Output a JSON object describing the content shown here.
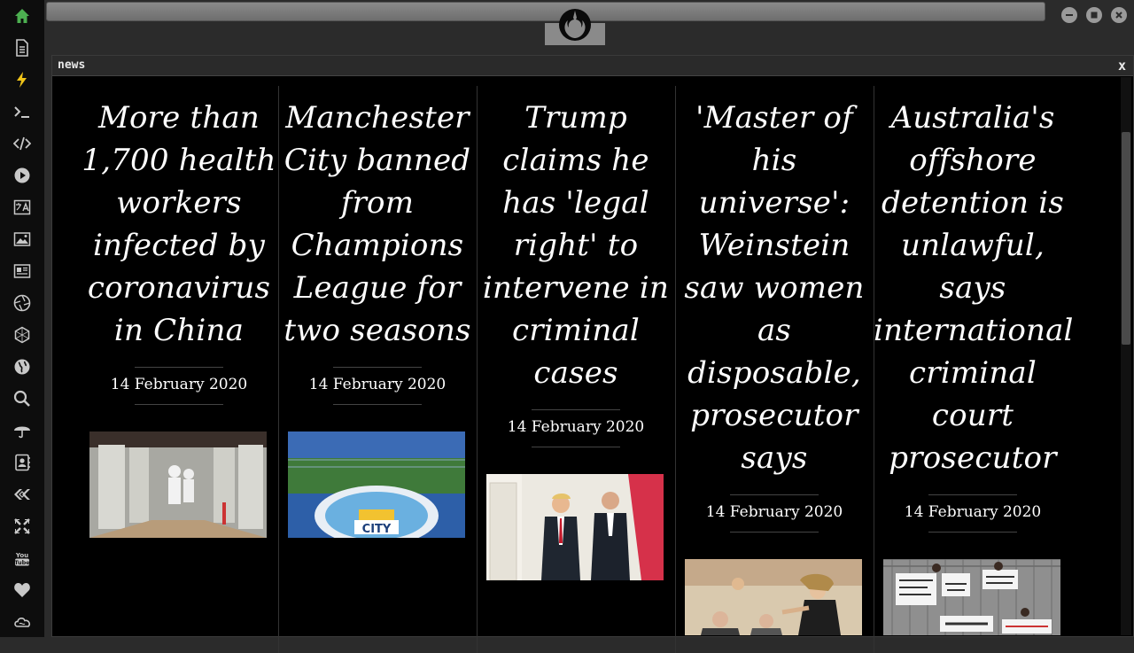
{
  "window": {
    "title": "news",
    "close": "x"
  },
  "articles": [
    {
      "title": "More than 1,700 health workers infected by coronavirus in China",
      "date": "14 February 2020",
      "image": "health-workers-photo"
    },
    {
      "title": "Manchester City banned from Champions League for two seasons",
      "date": "14 February 2020",
      "image": "manchester-city-logo-photo"
    },
    {
      "title": "Trump claims he has 'legal right' to intervene in criminal cases",
      "date": "14 February 2020",
      "image": "trump-barr-photo"
    },
    {
      "title": "'Master of his universe': Weinstein saw women as disposable, prosecutor says",
      "date": "14 February 2020",
      "image": "courtroom-sketch"
    },
    {
      "title": "Australia's offshore detention is unlawful, says international criminal court prosecutor",
      "date": "14 February 2020",
      "image": "protest-signs-photo"
    }
  ],
  "icons": [
    "home-icon",
    "document-icon",
    "lightning-icon",
    "terminal-icon",
    "code-icon",
    "play-icon",
    "translate-icon",
    "image-icon",
    "news-icon",
    "aperture-icon",
    "hexagon-icon",
    "globe-icon",
    "search-icon",
    "umbrella-icon",
    "contacts-icon",
    "tag-icon",
    "expand-icon",
    "youtube-icon",
    "heart-icon",
    "cloud-icon"
  ],
  "colors": {
    "home_icon": "#4caf50",
    "lightning_icon": "#f0c419",
    "sidebar_icon": "#c8c8c8"
  }
}
